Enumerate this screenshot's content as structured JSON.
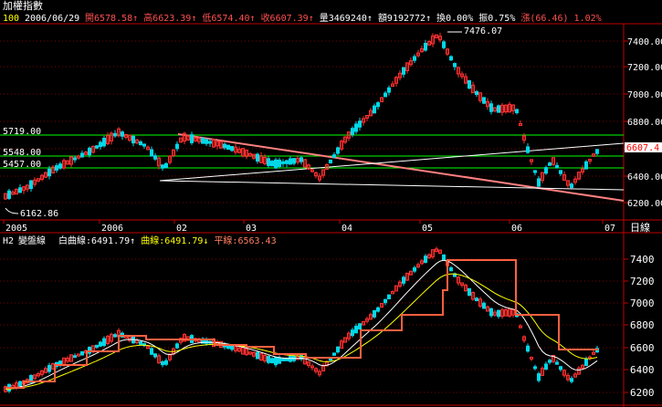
{
  "window": {
    "title": "加權指數"
  },
  "info_bar": {
    "code": "100",
    "date": "2006/06/29",
    "items": [
      {
        "label": "開",
        "value": "6578.58",
        "arrow": "↑",
        "color": "#ff5050"
      },
      {
        "label": "高",
        "value": "6623.39",
        "arrow": "↑",
        "color": "#ff5050"
      },
      {
        "label": "低",
        "value": "6574.40",
        "arrow": "↑",
        "color": "#ff5050"
      },
      {
        "label": "收",
        "value": "6607.39",
        "arrow": "↑",
        "color": "#ff5050"
      },
      {
        "label": "量",
        "value": "3469240",
        "arrow": "↑",
        "color": "#ffffff"
      },
      {
        "label": "額",
        "value": "9192772",
        "arrow": "↑",
        "color": "#ffffff"
      },
      {
        "label": "換",
        "value": "0.00%",
        "arrow": "",
        "color": "#ffffff"
      },
      {
        "label": "振",
        "value": "0.75%",
        "arrow": "",
        "color": "#ffffff"
      },
      {
        "label": "漲",
        "value": "(66.46)",
        "arrow": "",
        "color": "#ff5050"
      },
      {
        "label": "",
        "value": "1.02%",
        "arrow": "",
        "color": "#ff5050"
      }
    ]
  },
  "main_chart": {
    "peak_label": "7476.07",
    "low_label": "6162.86",
    "last_price": "6607.4",
    "level_lines": [
      "5719.00",
      "5548.00",
      "5457.00"
    ],
    "y_ticks": [
      "7400.00",
      "7200.00",
      "7000.00",
      "6800.00",
      "6600.00",
      "6400.00",
      "6200.00"
    ],
    "x_ticks": [
      "2005",
      "2006",
      "02",
      "03",
      "04",
      "05",
      "06",
      "07"
    ],
    "period": "日線"
  },
  "sub_chart": {
    "title": "H2",
    "name": "變盤線",
    "legend": [
      {
        "label": "白曲線:",
        "value": "6491.79",
        "arrow": "↑",
        "color": "#ffffff"
      },
      {
        "label": "曲線:",
        "value": "6491.79",
        "arrow": "↓",
        "color": "#ffff00"
      },
      {
        "label": "平線:",
        "value": "6563.43",
        "arrow": "",
        "color": "#ff8060"
      }
    ],
    "y_ticks": [
      "7400",
      "7200",
      "7000",
      "6800",
      "6600",
      "6400",
      "6200"
    ]
  },
  "colors": {
    "up": "#ff3030",
    "down": "#00d8e8",
    "grid": "#800000",
    "axis": "#c00000",
    "level": "#00ff00",
    "trend": "#ff8080"
  }
}
